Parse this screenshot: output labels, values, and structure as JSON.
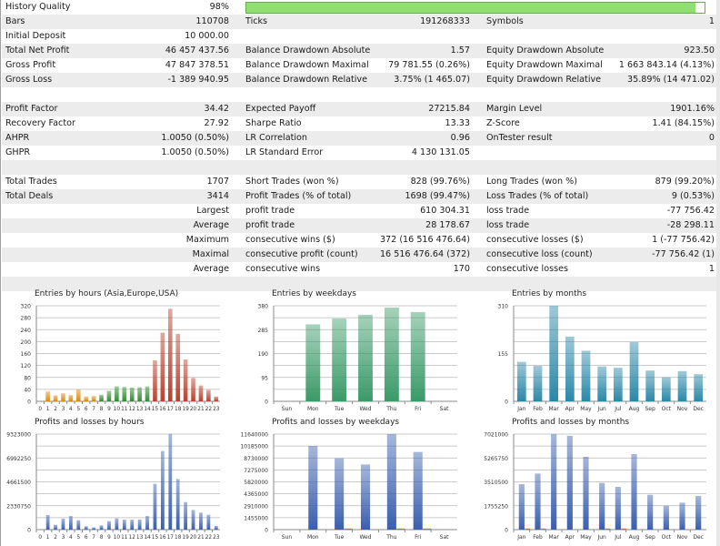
{
  "history_quality": {
    "label": "History Quality",
    "value": "98%",
    "progress_percent": 98,
    "bar_color": "#8fe070"
  },
  "table": [
    [
      "Bars",
      "110708",
      "Ticks",
      "191268333",
      "Symbols",
      "1"
    ],
    [
      "Initial Deposit",
      "10 000.00",
      "",
      "",
      "",
      ""
    ],
    [
      "Total Net Profit",
      "46 457 437.56",
      "Balance Drawdown Absolute",
      "1.57",
      "Equity Drawdown Absolute",
      "923.50"
    ],
    [
      "Gross Profit",
      "47 847 378.51",
      "Balance Drawdown Maximal",
      "79 781.55 (0.26%)",
      "Equity Drawdown Maximal",
      "1 663 843.14 (4.13%)"
    ],
    [
      "Gross Loss",
      "-1 389 940.95",
      "Balance Drawdown Relative",
      "3.75% (1 465.07)",
      "Equity Drawdown Relative",
      "35.89% (14 471.02)"
    ],
    [
      "",
      "",
      "",
      "",
      "",
      ""
    ],
    [
      "Profit Factor",
      "34.42",
      "Expected Payoff",
      "27215.84",
      "Margin Level",
      "1901.16%"
    ],
    [
      "Recovery Factor",
      "27.92",
      "Sharpe Ratio",
      "13.33",
      "Z-Score",
      "1.41 (84.15%)"
    ],
    [
      "AHPR",
      "1.0050 (0.50%)",
      "LR Correlation",
      "0.96",
      "OnTester result",
      "0"
    ],
    [
      "GHPR",
      "1.0050 (0.50%)",
      "LR Standard Error",
      "4 130 131.05",
      "",
      ""
    ],
    [
      "",
      "",
      "",
      "",
      "",
      ""
    ],
    [
      "Total Trades",
      "1707",
      "Short Trades (won %)",
      "828 (99.76%)",
      "Long Trades (won %)",
      "879 (99.20%)"
    ],
    [
      "Total Deals",
      "3414",
      "Profit Trades (% of total)",
      "1698 (99.47%)",
      "Loss Trades (% of total)",
      "9 (0.53%)"
    ],
    [
      "",
      "Largest",
      "profit trade",
      "610 304.31",
      "loss trade",
      "-77 756.42"
    ],
    [
      "",
      "Average",
      "profit trade",
      "28 178.67",
      "loss trade",
      "-28 298.11"
    ],
    [
      "",
      "Maximum",
      "consecutive wins ($)",
      "372 (16 516 476.64)",
      "consecutive losses ($)",
      "1 (-77 756.42)"
    ],
    [
      "",
      "Maximal",
      "consecutive profit (count)",
      "16 516 476.64 (372)",
      "consecutive loss (count)",
      "-77 756.42 (1)"
    ],
    [
      "",
      "Average",
      "consecutive wins",
      "170",
      "consecutive losses",
      "1"
    ],
    [
      "",
      "",
      "",
      "",
      "",
      ""
    ]
  ],
  "chart_data": [
    {
      "type": "bar",
      "title": "Entries by hours (Asia,Europe,USA)",
      "ylim": [
        0,
        320
      ],
      "yticks": [
        "0",
        "40",
        "80",
        "120",
        "160",
        "200",
        "240",
        "280",
        "320"
      ],
      "categories": [
        "0",
        "1",
        "2",
        "3",
        "4",
        "5",
        "6",
        "7",
        "8",
        "9",
        "10",
        "11",
        "12",
        "13",
        "14",
        "15",
        "16",
        "17",
        "18",
        "19",
        "20",
        "21",
        "22",
        "23"
      ],
      "values": [
        0,
        33,
        20,
        27,
        21,
        40,
        16,
        18,
        22,
        35,
        50,
        48,
        46,
        47,
        50,
        137,
        230,
        310,
        226,
        140,
        78,
        53,
        38,
        16
      ],
      "groups": [
        "Asia",
        "Asia",
        "Asia",
        "Asia",
        "Asia",
        "Asia",
        "Asia",
        "Asia",
        "Europe",
        "Europe",
        "Europe",
        "Europe",
        "Europe",
        "Europe",
        "Europe",
        "USA",
        "USA",
        "USA",
        "USA",
        "USA",
        "USA",
        "USA",
        "USA",
        "USA"
      ],
      "colors": {
        "Asia": "#d98a12",
        "Europe": "#2f8c2f",
        "USA": "#b8412c"
      },
      "grid": true
    },
    {
      "type": "bar",
      "title": "Entries by weekdays",
      "ylim": [
        0,
        380
      ],
      "yticks": [
        "0",
        "95",
        "190",
        "285",
        "380"
      ],
      "categories": [
        "Sun",
        "Mon",
        "Tue",
        "Wed",
        "Thu",
        "Fri",
        "Sat"
      ],
      "values": [
        0,
        306,
        329,
        344,
        373,
        355,
        0
      ],
      "color": "#3a9a68",
      "grid": true
    },
    {
      "type": "bar",
      "title": "Entries by months",
      "ylim": [
        0,
        310
      ],
      "yticks": [
        "0",
        "155",
        "310"
      ],
      "categories": [
        "Jan",
        "Feb",
        "Mar",
        "Apr",
        "May",
        "Jun",
        "Jul",
        "Aug",
        "Sep",
        "Oct",
        "Nov",
        "Dec"
      ],
      "values": [
        128,
        115,
        310,
        210,
        164,
        113,
        109,
        192,
        100,
        78,
        98,
        88
      ],
      "color": "#2a88a8",
      "grid": true
    },
    {
      "type": "bar",
      "title": "Profits and losses by hours",
      "ylim": [
        0,
        9323000
      ],
      "yticks": [
        "0",
        "2330750",
        "4661500",
        "6992250",
        "9323000"
      ],
      "categories": [
        "0",
        "1",
        "2",
        "3",
        "4",
        "5",
        "6",
        "7",
        "8",
        "9",
        "10",
        "11",
        "12",
        "13",
        "14",
        "15",
        "16",
        "17",
        "18",
        "19",
        "20",
        "21",
        "22",
        "23"
      ],
      "series": [
        {
          "values": [
            0,
            1420000,
            470000,
            1070000,
            1330000,
            920000,
            330000,
            210000,
            410000,
            830000,
            1100000,
            980000,
            980000,
            980000,
            1330000,
            4470000,
            7670000,
            9323000,
            4940000,
            2690000,
            1920000,
            1660000,
            1450000,
            360000
          ],
          "color": "#3a5fae"
        },
        {
          "values": [
            0,
            0,
            0,
            0,
            0,
            0,
            0,
            0,
            0,
            0,
            0,
            0,
            0,
            0,
            0,
            0,
            0,
            0,
            0,
            0,
            0,
            0,
            0,
            0
          ],
          "color": "#e0603a"
        }
      ],
      "grid": true
    },
    {
      "type": "bar",
      "title": "Profits and losses by weekdays",
      "ylim": [
        0,
        11640000
      ],
      "yticks": [
        "0",
        "1455000",
        "2910000",
        "4365000",
        "5820000",
        "7275000",
        "8730000",
        "10185000",
        "11640000"
      ],
      "categories": [
        "Sun",
        "Mon",
        "Tue",
        "Wed",
        "Thu",
        "Fri",
        "Sat"
      ],
      "series": [
        {
          "values": [
            0,
            10200000,
            8680000,
            7940000,
            11640000,
            9460000,
            0
          ],
          "color": "#3a5fae"
        },
        {
          "values": [
            0,
            0,
            20000,
            0,
            130000,
            60000,
            0
          ],
          "color": "#e0603a"
        }
      ],
      "grid": true
    },
    {
      "type": "bar",
      "title": "Profits and losses by months",
      "ylim": [
        0,
        7021000
      ],
      "yticks": [
        "0",
        "1755250",
        "3510500",
        "5265750",
        "7021000"
      ],
      "categories": [
        "Jan",
        "Feb",
        "Mar",
        "Apr",
        "May",
        "Jun",
        "Jul",
        "Aug",
        "Sep",
        "Oct",
        "Nov",
        "Dec"
      ],
      "series": [
        {
          "values": [
            3340000,
            4120000,
            7021000,
            6890000,
            5350000,
            3430000,
            3140000,
            5550000,
            2560000,
            1760000,
            1980000,
            2470000
          ],
          "color": "#3a5fae"
        },
        {
          "values": [
            50000,
            50000,
            0,
            0,
            0,
            30000,
            30000,
            0,
            0,
            0,
            0,
            0
          ],
          "color": "#e0603a"
        }
      ],
      "grid": true
    }
  ]
}
